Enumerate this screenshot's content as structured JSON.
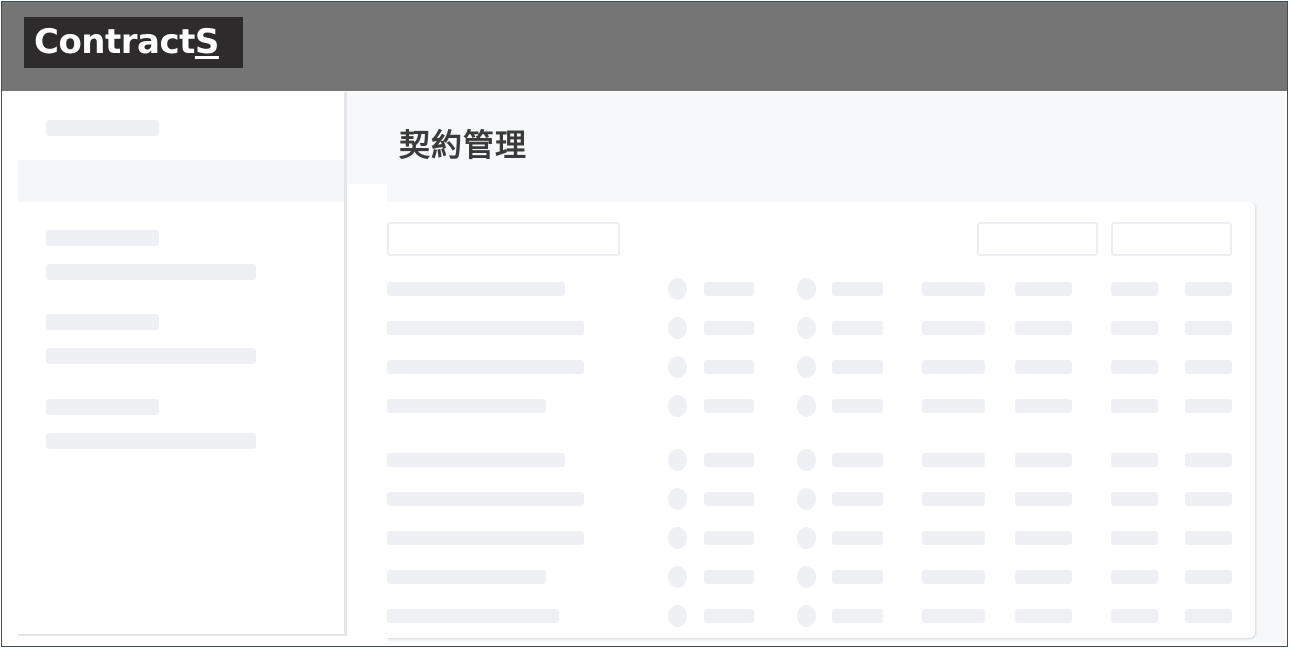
{
  "app": {
    "logo_main": "Contract",
    "logo_last": "S"
  },
  "main": {
    "title": "契約管理"
  },
  "colors": {
    "topbar": "#757575",
    "logo_bg": "#2d2b2b",
    "skeleton": "#eef0f3",
    "content_bg": "#f7f8fa"
  }
}
